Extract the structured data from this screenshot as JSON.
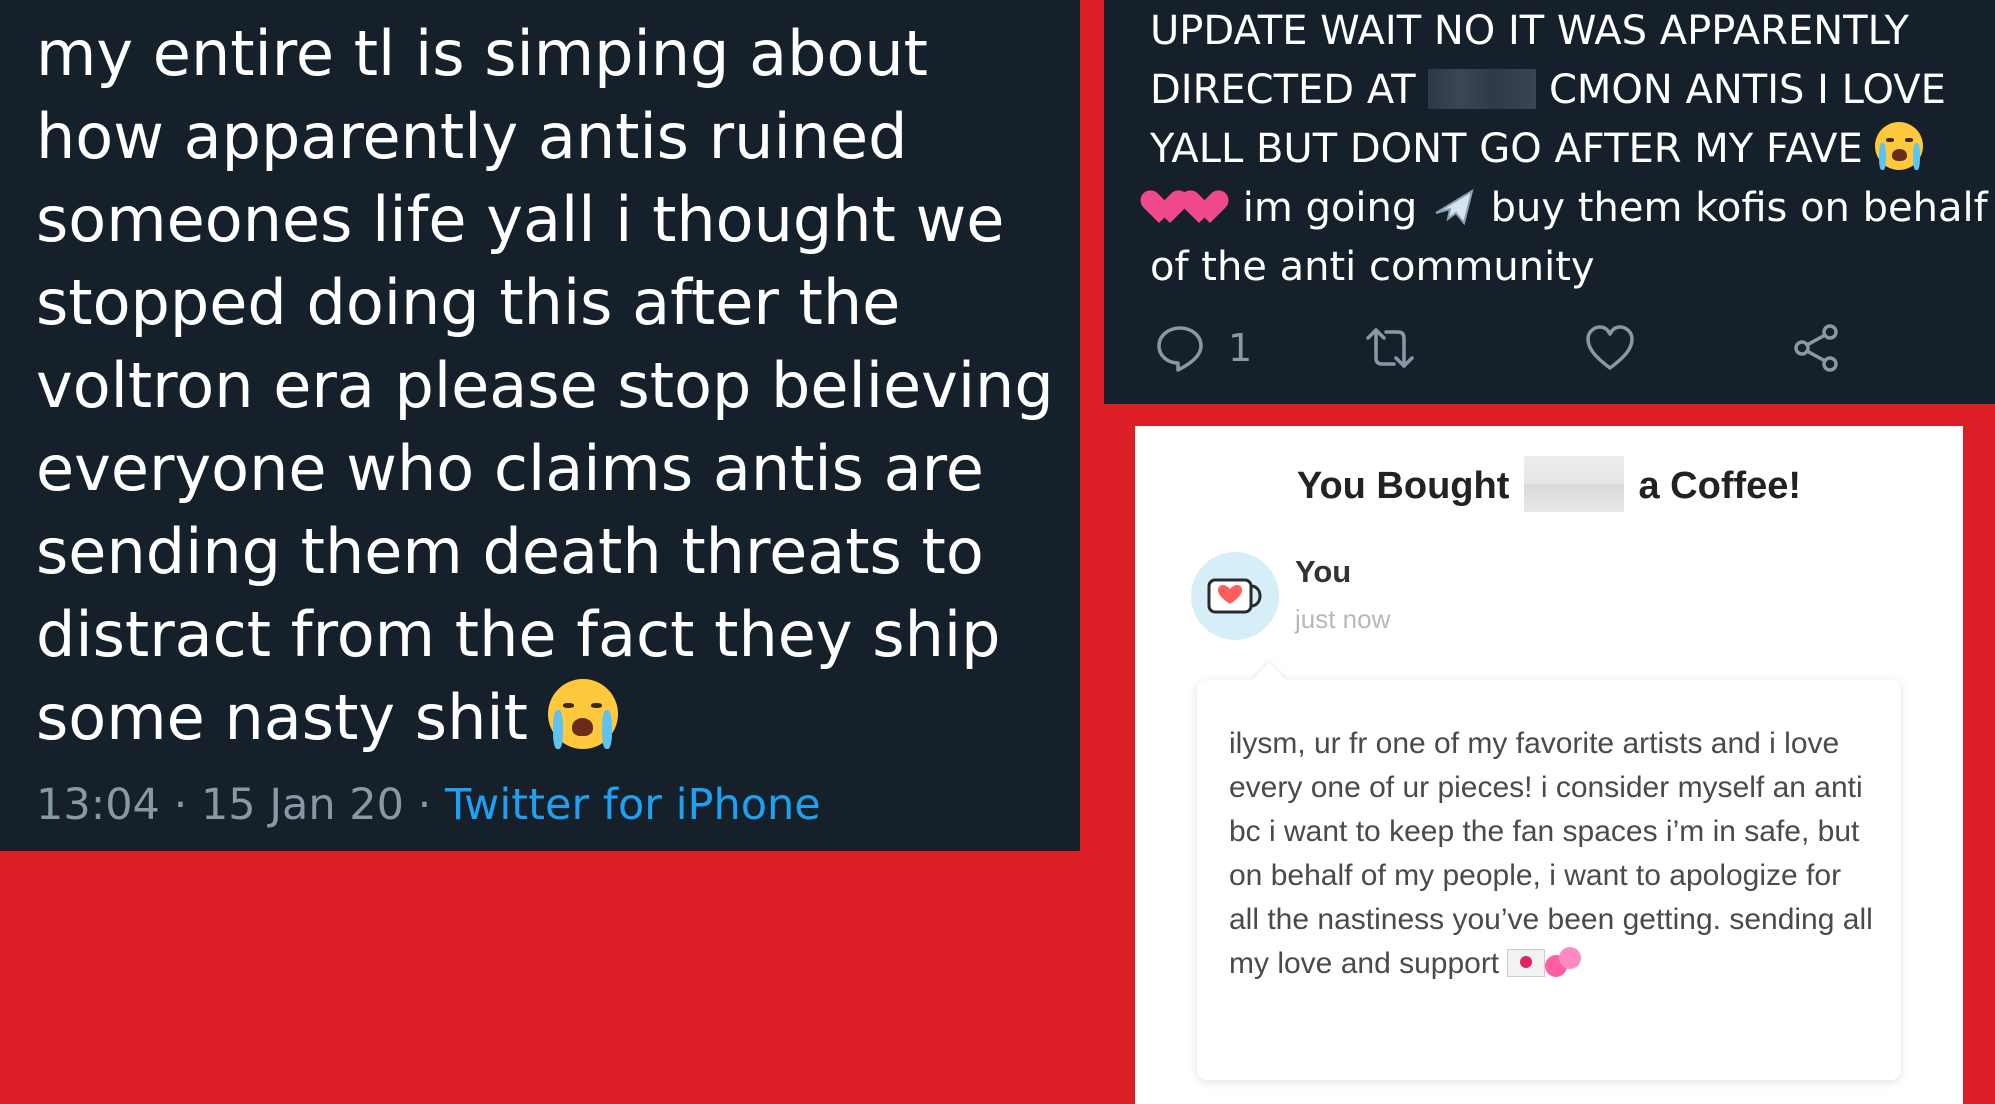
{
  "left_tweet": {
    "text": "my entire tl is simping about how apparently antis ruined someones life yall i thought we stopped doing this after the voltron era please stop believing everyone who claims antis are sending them death threats to distract from the fact they ship some nasty shit",
    "emoji": "loudly-crying-face",
    "time": "13:04",
    "date": "15 Jan 20",
    "separator": " · ",
    "source": "Twitter for iPhone"
  },
  "right_tweet": {
    "text_part1": "UPDATE WAIT NO IT WAS APPARENTLY DIRECTED AT ",
    "text_part2": " CMON ANTIS I LOVE YALL BUT DONT GO AFTER MY FAVE ",
    "text_part3": " im going ",
    "text_part4": "  buy them kofis on behalf of the anti community",
    "reply_count": "1",
    "colors": {
      "background": "#15202b",
      "text": "#ffffff",
      "icon": "#8899a6"
    }
  },
  "coffee_card": {
    "title_before": "You Bought ",
    "title_after": " a Coffee!",
    "user_name": "You",
    "user_time": "just now",
    "message": "ilysm, ur fr one of my favorite artists and i love every one of ur pieces! i consider myself an anti bc i want to keep the fan spaces i’m in safe, but on behalf of my people, i want to apologize for all the nastiness you’ve been getting. sending all my love and support "
  },
  "colors": {
    "page_background": "#dc1f26",
    "link": "#1da1f2",
    "muted": "#8899a6"
  }
}
